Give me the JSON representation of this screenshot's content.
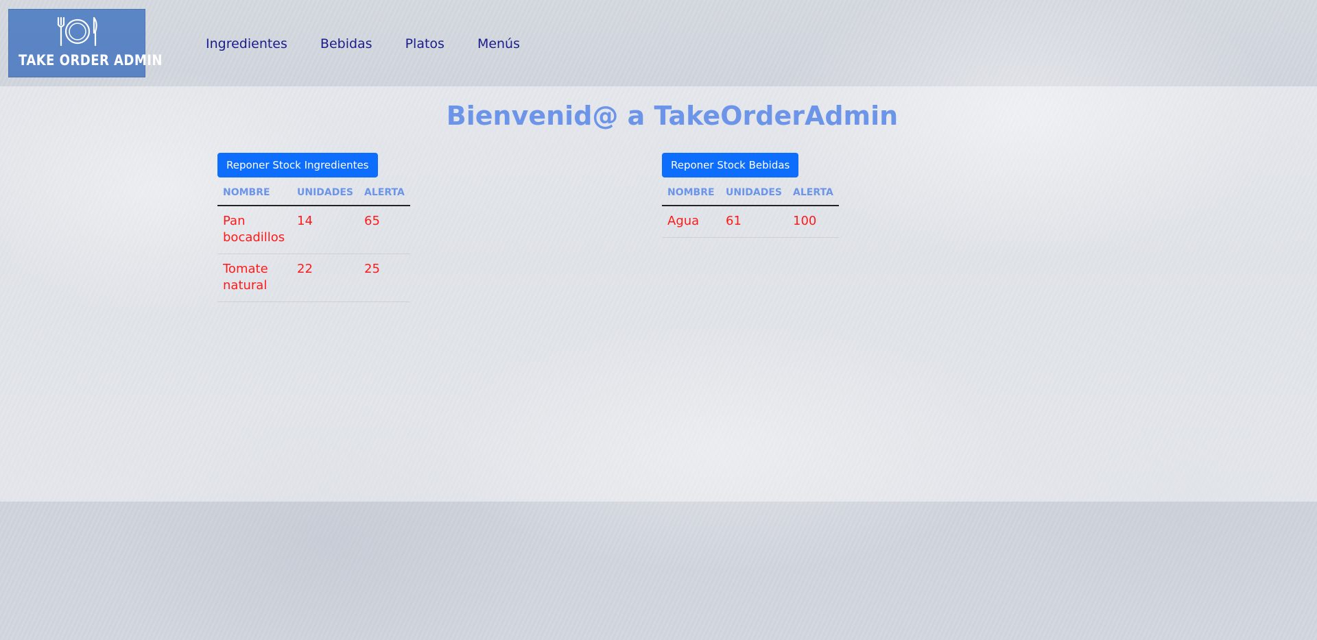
{
  "logo": {
    "text": "TAKE ORDER ADMIN",
    "icon": "plate-fork-knife-icon",
    "background_color": "#5b86c6"
  },
  "nav": {
    "items": [
      "Ingredientes",
      "Bebidas",
      "Platos",
      "Menús"
    ],
    "color": "#1a1d8a"
  },
  "main": {
    "title": "Bienvenid@ a TakeOrderAdmin",
    "title_color": "#6c94e8"
  },
  "ingredientes": {
    "button_label": "Reponer Stock Ingredientes",
    "headers": [
      "NOMBRE",
      "UNIDADES",
      "ALERTA"
    ],
    "rows": [
      [
        "Pan bocadillos",
        "14",
        "65"
      ],
      [
        "Tomate natural",
        "22",
        "25"
      ]
    ]
  },
  "bebidas": {
    "button_label": "Reponer Stock Bebidas",
    "headers": [
      "NOMBRE",
      "UNIDADES",
      "ALERTA"
    ],
    "rows": [
      [
        "Agua",
        "61",
        "100"
      ]
    ]
  },
  "colors": {
    "button": "#0d6efd",
    "alert_text": "#ff1a1a",
    "header_text": "#6c94e8"
  }
}
